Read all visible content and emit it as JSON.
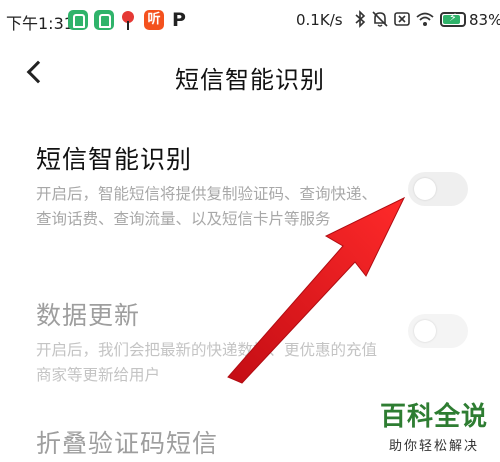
{
  "status_bar": {
    "time": "下午1:31",
    "notification_icons": [
      "green-app-icon",
      "green-app-icon",
      "map-pin-icon",
      "news-app-icon",
      "p-app-icon"
    ],
    "news_icon_text": "听",
    "p_icon_text": "P",
    "network_speed": "0.1K/s",
    "battery_percent": "83%",
    "battery_level": 0.83
  },
  "header": {
    "title": "短信智能识别"
  },
  "settings": [
    {
      "title": "短信智能识别",
      "description": "开启后，智能短信将提供复制验证码、查询快递、查询话费、查询流量、以及短信卡片等服务",
      "enabled": false,
      "dimmed": false
    },
    {
      "title": "数据更新",
      "description": "开启后，我们会把最新的快递数据、更优惠的充值商家等更新给用户",
      "enabled": false,
      "dimmed": true
    },
    {
      "title": "折叠验证码短信",
      "dimmed": true
    }
  ],
  "colors": {
    "arrow": "#e8141c",
    "watermark": "#2e7d32"
  },
  "watermark": {
    "main": "百科全说",
    "sub": "助你轻松解决"
  }
}
